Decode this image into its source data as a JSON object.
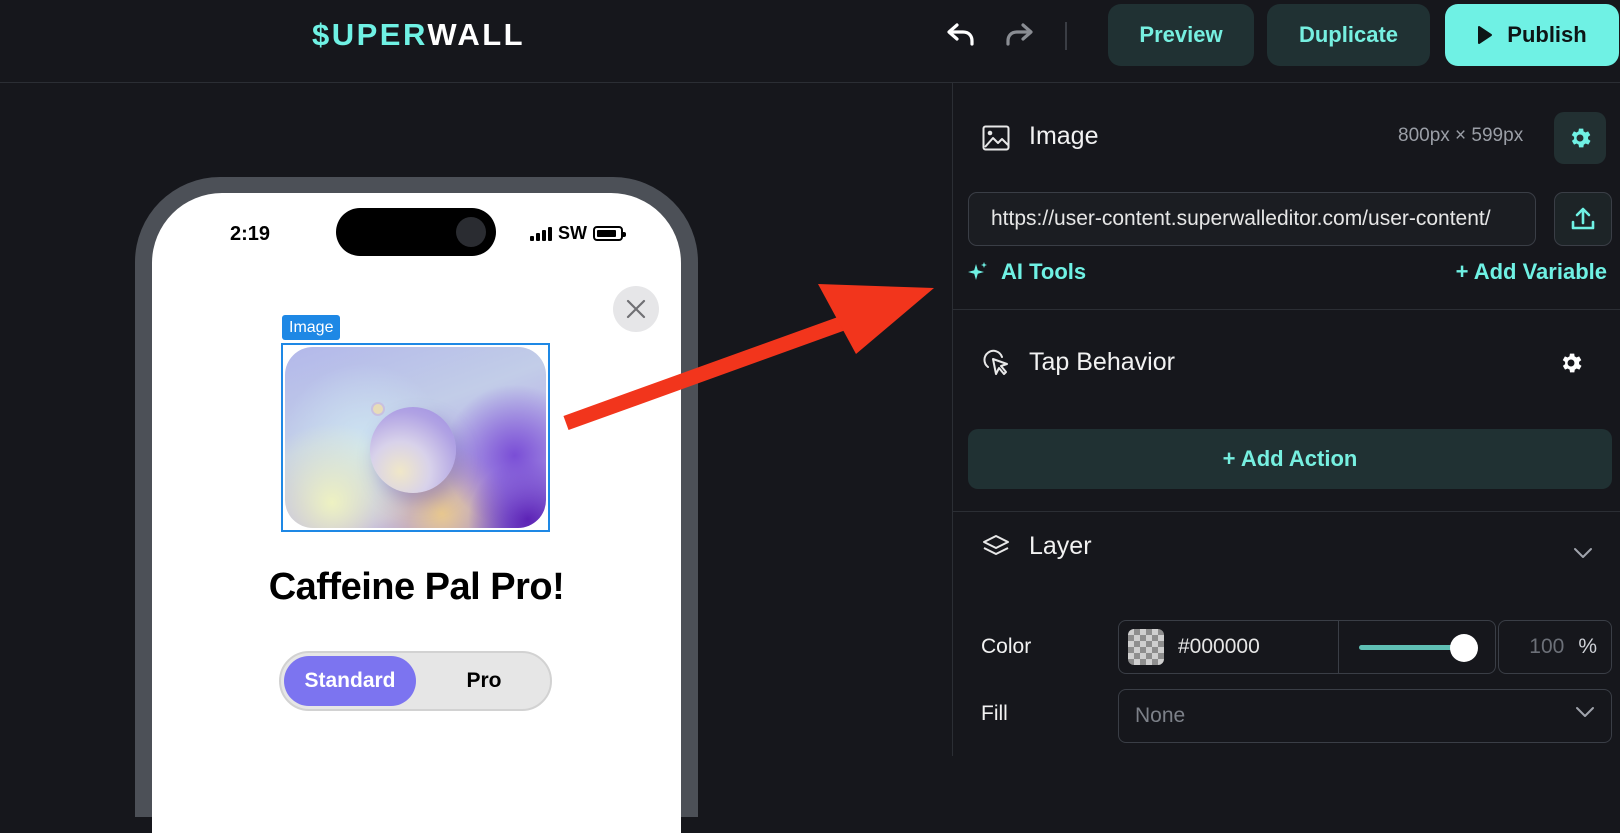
{
  "app": {
    "logo_part1": "$UPER",
    "logo_part2": "WALL"
  },
  "toolbar": {
    "undo_icon": "undo-icon",
    "redo_icon": "redo-icon",
    "preview_label": "Preview",
    "duplicate_label": "Duplicate",
    "publish_label": "Publish"
  },
  "phone": {
    "time": "2:19",
    "carrier": "SW",
    "image_tag": "Image",
    "title": "Caffeine Pal Pro!",
    "segments": [
      "Standard",
      "Pro"
    ],
    "selected_segment": "Standard"
  },
  "panel": {
    "image": {
      "title": "Image",
      "dimensions": "800px × 599px",
      "url": "https://user-content.superwalleditor.com/user-content/",
      "ai_tools_label": "AI Tools",
      "add_variable_label": "+ Add Variable"
    },
    "tap_behavior": {
      "title": "Tap Behavior",
      "add_action_label": "+ Add Action"
    },
    "layer": {
      "title": "Layer",
      "color_label": "Color",
      "color_hex": "#000000",
      "opacity": "100",
      "opacity_unit": "%",
      "opacity_fraction": 1.0,
      "fill_label": "Fill",
      "fill_value": "None"
    }
  },
  "colors": {
    "accent": "#6ff1e4",
    "button_bg": "#203133",
    "selection": "#1e88e5",
    "segment_selected": "#7c74f0",
    "arrow": "#f2351c"
  }
}
